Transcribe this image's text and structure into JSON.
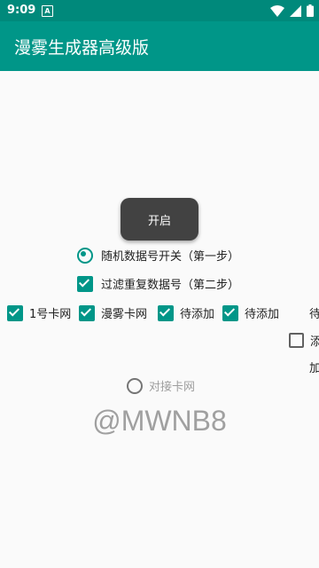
{
  "status_bar": {
    "time": "9:09",
    "notif_glyph": "A"
  },
  "app_bar": {
    "title": "漫雾生成器高级版"
  },
  "start_button": {
    "label": "开启"
  },
  "options": {
    "random_toggle": "随机数据号开关（第一步）",
    "filter_dup": "过滤重复数据号（第二步）"
  },
  "card_sources": {
    "cb1": "1号卡网",
    "cb2": "漫雾卡网",
    "cb3": "待添加",
    "cb4": "待添加",
    "overflow_text": "待"
  },
  "right_column": {
    "cb_text": "添",
    "add_text": "加"
  },
  "connect": {
    "label": "对接卡网"
  },
  "watermark": "@MWNB8",
  "colors": {
    "primary": "#009688",
    "status": "#00897b",
    "button": "#424242"
  }
}
